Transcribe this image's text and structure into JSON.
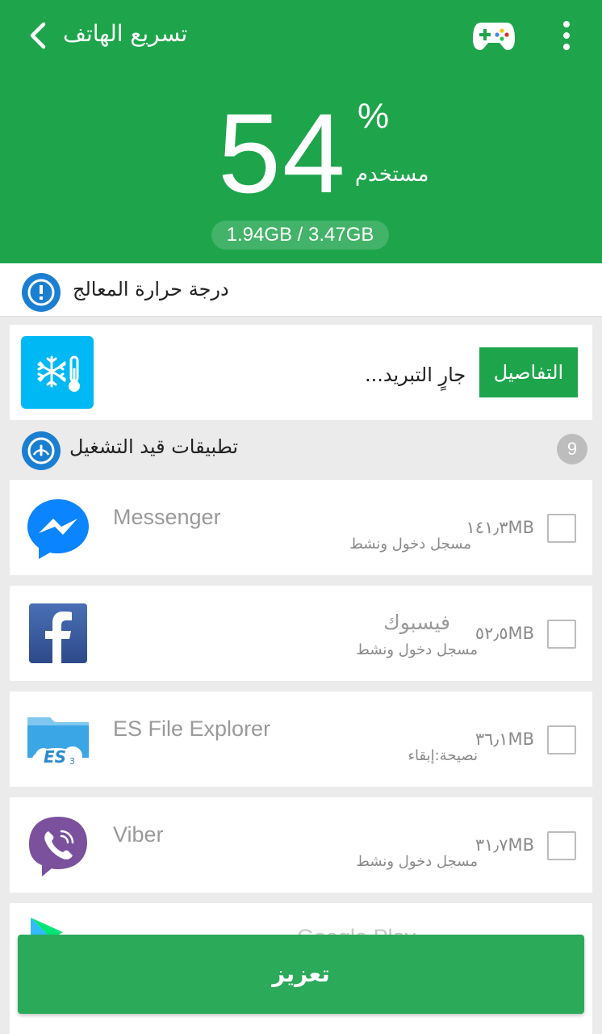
{
  "header": {
    "title": "تسريع الهاتف",
    "percent_value": "54",
    "percent_sign": "%",
    "used_label": "مستخدم",
    "memory_text": "1.94GB / 3.47GB"
  },
  "cpu": {
    "label": "درجة حرارة المعالج"
  },
  "cooling": {
    "status_text": "جارٍ التبريد...",
    "details_label": "التفاصيل"
  },
  "apps_section": {
    "label": "تطبيقات قيد التشغيل",
    "count": "9"
  },
  "apps": [
    {
      "name": "Messenger",
      "size": "١٤١٫٣MB",
      "status": "مسجل دخول ونشط",
      "icon": "messenger-icon"
    },
    {
      "name": "فيسبوك",
      "size": "٥٢٫٥MB",
      "status": "مسجل دخول ونشط",
      "icon": "facebook-icon"
    },
    {
      "name": "ES File Explorer",
      "size": "٣٦٫١MB",
      "status": "نصيحة:إبقاء",
      "icon": "es-file-explorer-icon"
    },
    {
      "name": "Viber",
      "size": "٣١٫٧MB",
      "status": "مسجل دخول ونشط",
      "icon": "viber-icon"
    },
    {
      "name": "Google Play",
      "icon": "google-play-icon"
    }
  ],
  "boost_label": "تعزيز",
  "colors": {
    "brand_green": "#1ea54c",
    "cool_blue": "#00b8f4",
    "messenger_blue": "#0a84ff",
    "facebook_blue": "#3b5998",
    "viber_purple": "#7b519d"
  }
}
